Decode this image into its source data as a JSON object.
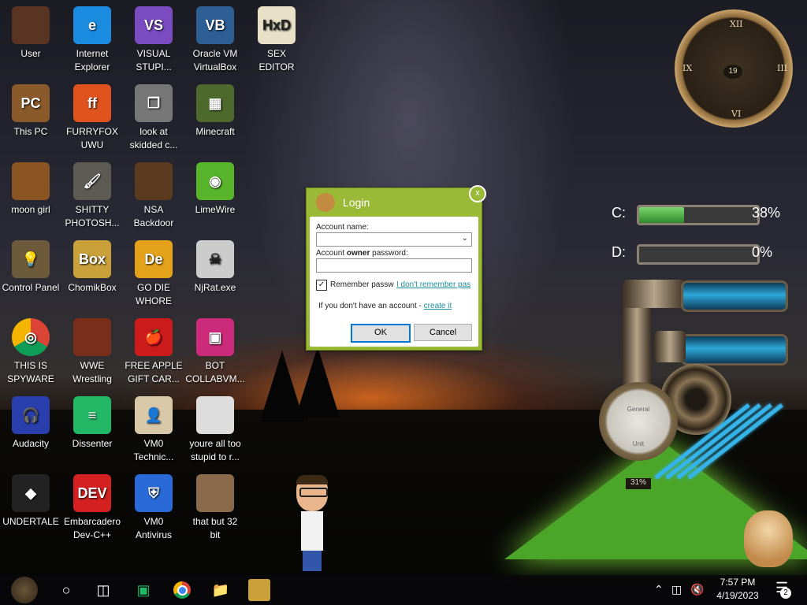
{
  "desktop": {
    "icons": [
      {
        "label": "User",
        "icon": "user-folder-icon",
        "color": "#5a3422",
        "glyph": ""
      },
      {
        "label": "Internet\nExplorer",
        "icon": "edge-icon",
        "color": "#1b8be0",
        "glyph": "e"
      },
      {
        "label": "VISUAL\nSTUPI...",
        "icon": "visual-studio-icon",
        "color": "#7b4bc2",
        "glyph": "VS"
      },
      {
        "label": "Oracle VM\nVirtualBox",
        "icon": "virtualbox-icon",
        "color": "#2d5f95",
        "glyph": "VB"
      },
      {
        "label": "SEX\nEDITOR",
        "icon": "hxd-icon",
        "color": "#e9e0c8",
        "glyph": "HxD"
      },
      {
        "label": "This PC",
        "icon": "this-pc-icon",
        "color": "#8a5a2a",
        "glyph": "PC"
      },
      {
        "label": "FURRYFOX\nUWU",
        "icon": "firefox-icon",
        "color": "#e0531f",
        "glyph": "ff"
      },
      {
        "label": "look at\nskidded c...",
        "icon": "copy-files-icon",
        "color": "#777777",
        "glyph": "❐"
      },
      {
        "label": "Minecraft",
        "icon": "minecraft-icon",
        "color": "#4d6a2c",
        "glyph": "▦"
      },
      {
        "label": "moon girl",
        "icon": "book-icon",
        "color": "#8a5522",
        "glyph": ""
      },
      {
        "label": "SHITTY\nPHOTOSH...",
        "icon": "gimp-icon",
        "color": "#5c5c55",
        "glyph": "🖌"
      },
      {
        "label": "NSA\nBackdoor",
        "icon": "steampunk-box-icon",
        "color": "#5a3b1f",
        "glyph": ""
      },
      {
        "label": "LimeWire",
        "icon": "limewire-icon",
        "color": "#58b42a",
        "glyph": "◉"
      },
      {
        "label": "Control Panel",
        "icon": "lightbulb-icon",
        "color": "#6d5a3a",
        "glyph": "💡"
      },
      {
        "label": "ChomikBox",
        "icon": "chomikbox-icon",
        "color": "#c9a03a",
        "glyph": "Box"
      },
      {
        "label": "GO DIE\nWHORE",
        "icon": "die-icon",
        "color": "#e3a21a",
        "glyph": "De"
      },
      {
        "label": "NjRat.exe",
        "icon": "skull-icon",
        "color": "#cccccc",
        "glyph": "☠"
      },
      {
        "label": "THIS IS\nSPYWARE",
        "icon": "chrome-icon",
        "color": "#dd3b2f",
        "glyph": "◎"
      },
      {
        "label": "WWE\nWrestling",
        "icon": "oven-icon",
        "color": "#7a2e1a",
        "glyph": ""
      },
      {
        "label": "FREE APPLE\nGIFT CAR...",
        "icon": "apple-icon",
        "color": "#cc1b1b",
        "glyph": "🍎"
      },
      {
        "label": "BOT\nCOLLABVM...",
        "icon": "monitor-icon",
        "color": "#cc2a7a",
        "glyph": "▣"
      },
      {
        "label": "Audacity",
        "icon": "audacity-icon",
        "color": "#2a3fae",
        "glyph": "🎧"
      },
      {
        "label": "Dissenter",
        "icon": "dissenter-icon",
        "color": "#22b866",
        "glyph": "≡"
      },
      {
        "label": "VM0\nTechnic...",
        "icon": "technician-icon",
        "color": "#d8c8a8",
        "glyph": "👤"
      },
      {
        "label": "youre all too\nstupid to r...",
        "icon": "portrait-icon",
        "color": "#dddddd",
        "glyph": ""
      },
      {
        "label": "UNDERTALE",
        "icon": "unity-icon",
        "color": "#222222",
        "glyph": "◆"
      },
      {
        "label": "Embarcadero\nDev-C++",
        "icon": "devcpp-icon",
        "color": "#d42020",
        "glyph": "DEV"
      },
      {
        "label": "VM0\nAntivirus",
        "icon": "shield-icon",
        "color": "#2a6ad8",
        "glyph": "⛨"
      },
      {
        "label": "that but 32\nbit",
        "icon": "woman-portrait-icon",
        "color": "#8a6a4a",
        "glyph": ""
      }
    ]
  },
  "login": {
    "title": "Login",
    "close": "x",
    "account_name_label": "Account name:",
    "account_name_value": "",
    "password_label_pre": "Account ",
    "password_label_bold": "owner",
    "password_label_post": " password:",
    "password_value": "",
    "remember_label": "Remember passw",
    "remember_checked": true,
    "forgot_link": "I don't remember pas",
    "no_account_text": "If you don't have an account - ",
    "create_link": "create it",
    "ok": "OK",
    "cancel": "Cancel"
  },
  "widgets": {
    "drive_c": {
      "letter": "C:",
      "percent_text": "38%",
      "fraction": 0.38
    },
    "drive_d": {
      "letter": "D:",
      "percent_text": "0%",
      "fraction": 0.0
    },
    "clock_day": "19",
    "gauge_value": "31%",
    "gauge_label_top": "General",
    "gauge_label_bottom": "Unit"
  },
  "taskbar": {
    "time": "7:57 PM",
    "date": "4/19/2023",
    "notifications": "2",
    "apps": [
      "start-button-icon",
      "cortana-icon",
      "task-view-icon",
      "dissenter-icon",
      "chrome-icon",
      "file-explorer-icon",
      "chomikbox-icon"
    ]
  }
}
